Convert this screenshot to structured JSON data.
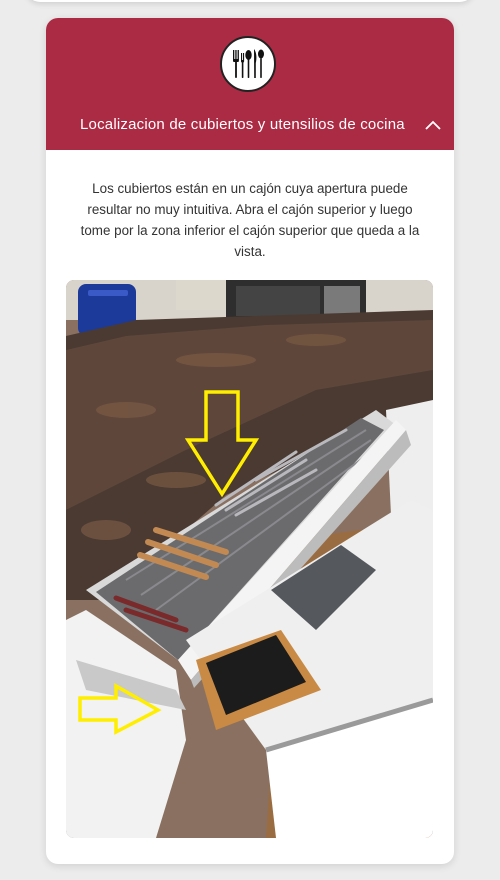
{
  "section": {
    "icon": "cutlery-icon",
    "title": "Localizacion de cubiertos y utensilios de cocina",
    "description": "Los cubiertos están en un cajón cuya apertura puede resultar no muy intuitiva. Abra el cajón superior y luego tome por la zona inferior el cajón superior que queda a la vista.",
    "expanded": true
  },
  "colors": {
    "accent": "#ab2b44",
    "highlight_arrow": "#ffee00"
  }
}
